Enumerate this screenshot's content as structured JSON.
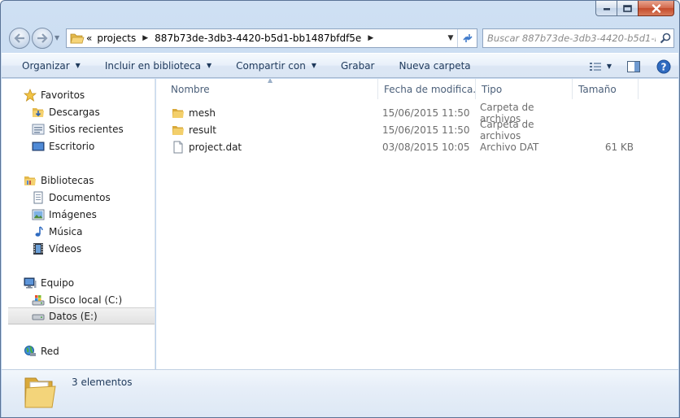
{
  "address": {
    "overflow_glyph": "«",
    "segments": [
      "projects",
      "887b73de-3db3-4420-b5d1-bb1487bfdf5e"
    ]
  },
  "search": {
    "placeholder": "Buscar 887b73de-3db3-4420-b5d1-bb..."
  },
  "toolbar": {
    "organize": "Organizar",
    "include_library": "Incluir en biblioteca",
    "share": "Compartir con",
    "burn": "Grabar",
    "new_folder": "Nueva carpeta"
  },
  "sidebar": {
    "favorites": {
      "label": "Favoritos",
      "items": [
        "Descargas",
        "Sitios recientes",
        "Escritorio"
      ]
    },
    "libraries": {
      "label": "Bibliotecas",
      "items": [
        "Documentos",
        "Imágenes",
        "Música",
        "Vídeos"
      ]
    },
    "computer": {
      "label": "Equipo",
      "items": [
        "Disco local (C:)",
        "Datos (E:)"
      ]
    },
    "network": {
      "label": "Red"
    }
  },
  "columns": {
    "name": "Nombre",
    "date": "Fecha de modifica...",
    "type": "Tipo",
    "size": "Tamaño"
  },
  "files": [
    {
      "name": "mesh",
      "date": "15/06/2015 11:50",
      "type": "Carpeta de archivos",
      "size": "",
      "icon": "folder-icon"
    },
    {
      "name": "result",
      "date": "15/06/2015 11:50",
      "type": "Carpeta de archivos",
      "size": "",
      "icon": "folder-icon"
    },
    {
      "name": "project.dat",
      "date": "03/08/2015 10:05",
      "type": "Archivo DAT",
      "size": "61 KB",
      "icon": "file-icon"
    }
  ],
  "status": {
    "item_count": "3 elementos"
  },
  "colors": {
    "chrome": "#bcd3ee",
    "command_bar": "#dce7f5",
    "command_text": "#1e395b",
    "close_button": "#c44b2c",
    "folder": "#e8c15a"
  }
}
